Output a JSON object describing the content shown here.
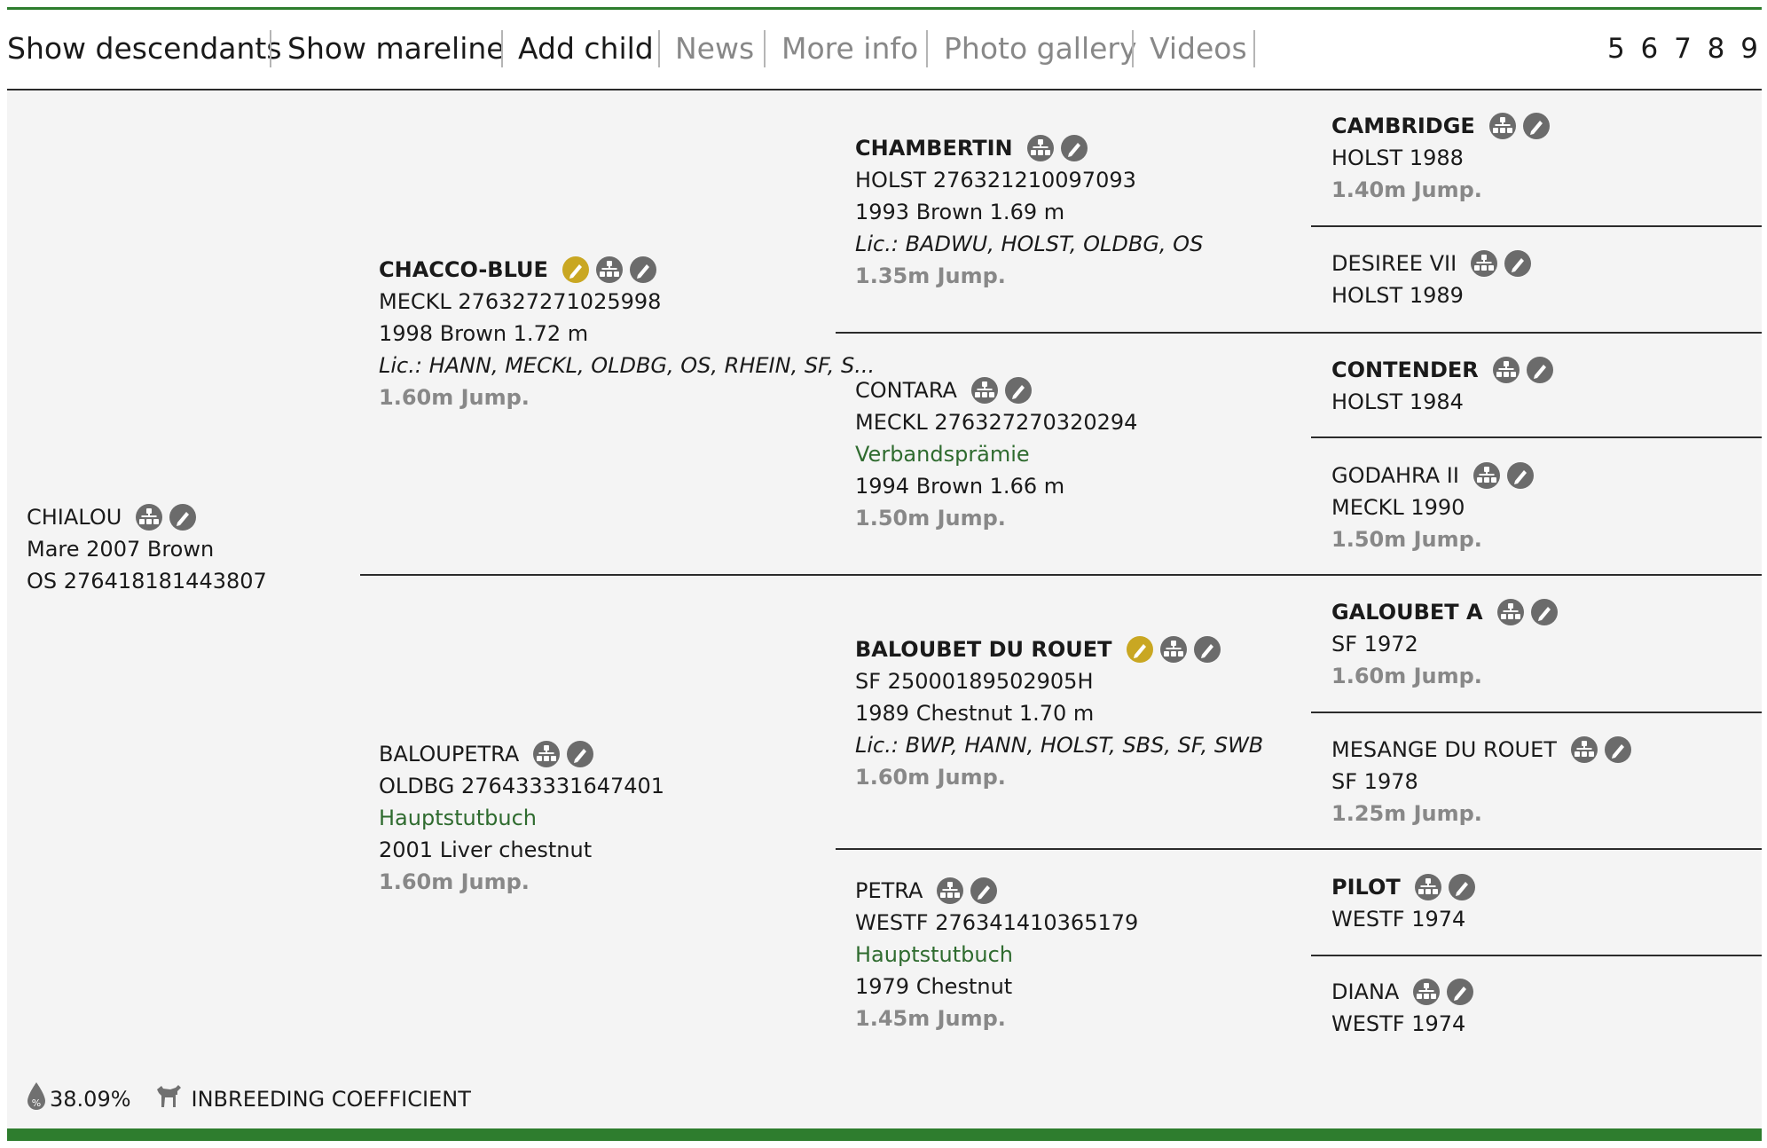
{
  "toolbar": {
    "items": [
      "Show descendants",
      "Show mareline",
      "Add child",
      "News",
      "More info",
      "Photo gallery",
      "Videos"
    ],
    "pages": "5 6 7 8 9"
  },
  "subject": {
    "name": "CHIALOU",
    "l1": "Mare 2007 Brown",
    "l2": "OS 276418181443807"
  },
  "sire": {
    "name": "CHACCO-BLUE",
    "l1": "MECKL 276327271025998",
    "l2": "1998 Brown 1.72 m",
    "lic": "Lic.: HANN, MECKL, OLDBG, OS, RHEIN, SF, S...",
    "jump": "1.60m Jump."
  },
  "dam": {
    "name": "BALOUPETRA",
    "l1": "OLDBG 276433331647401",
    "book": "Hauptstutbuch",
    "l2": "2001 Liver chestnut",
    "jump": "1.60m Jump."
  },
  "ss": {
    "name": "CHAMBERTIN",
    "l1": "HOLST 276321210097093",
    "l2": "1993 Brown 1.69 m",
    "lic": "Lic.: BADWU, HOLST, OLDBG, OS",
    "jump": "1.35m Jump."
  },
  "sd": {
    "name": "CONTARA",
    "l1": "MECKL 276327270320294",
    "book": "Verbandsprämie",
    "l2": "1994 Brown 1.66 m",
    "jump": "1.50m Jump."
  },
  "ds": {
    "name": "BALOUBET DU ROUET",
    "l1": "SF 25000189502905H",
    "l2": "1989 Chestnut 1.70 m",
    "lic": "Lic.: BWP, HANN, HOLST, SBS, SF, SWB",
    "jump": "1.60m Jump."
  },
  "dd": {
    "name": "PETRA",
    "l1": "WESTF 276341410365179",
    "book": "Hauptstutbuch",
    "l2": "1979 Chestnut",
    "jump": "1.45m Jump."
  },
  "g": [
    {
      "name": "CAMBRIDGE",
      "l1": "HOLST 1988",
      "jump": "1.40m Jump."
    },
    {
      "name": "DESIREE VII",
      "l1": "HOLST 1989"
    },
    {
      "name": "CONTENDER",
      "l1": "HOLST 1984"
    },
    {
      "name": "GODAHRA II",
      "l1": "MECKL 1990",
      "jump": "1.50m Jump."
    },
    {
      "name": "GALOUBET A",
      "l1": "SF 1972",
      "jump": "1.60m Jump."
    },
    {
      "name": "MESANGE DU ROUET",
      "l1": "SF 1978",
      "jump": "1.25m Jump."
    },
    {
      "name": "PILOT",
      "l1": "WESTF 1974"
    },
    {
      "name": "DIANA",
      "l1": "WESTF 1974"
    }
  ],
  "footer": {
    "percent": "38.09%",
    "label": "INBREEDING COEFFICIENT"
  },
  "colors": {
    "green": "#2e7d2e",
    "gold": "#c9a722",
    "icon": "#6b6b6b"
  }
}
